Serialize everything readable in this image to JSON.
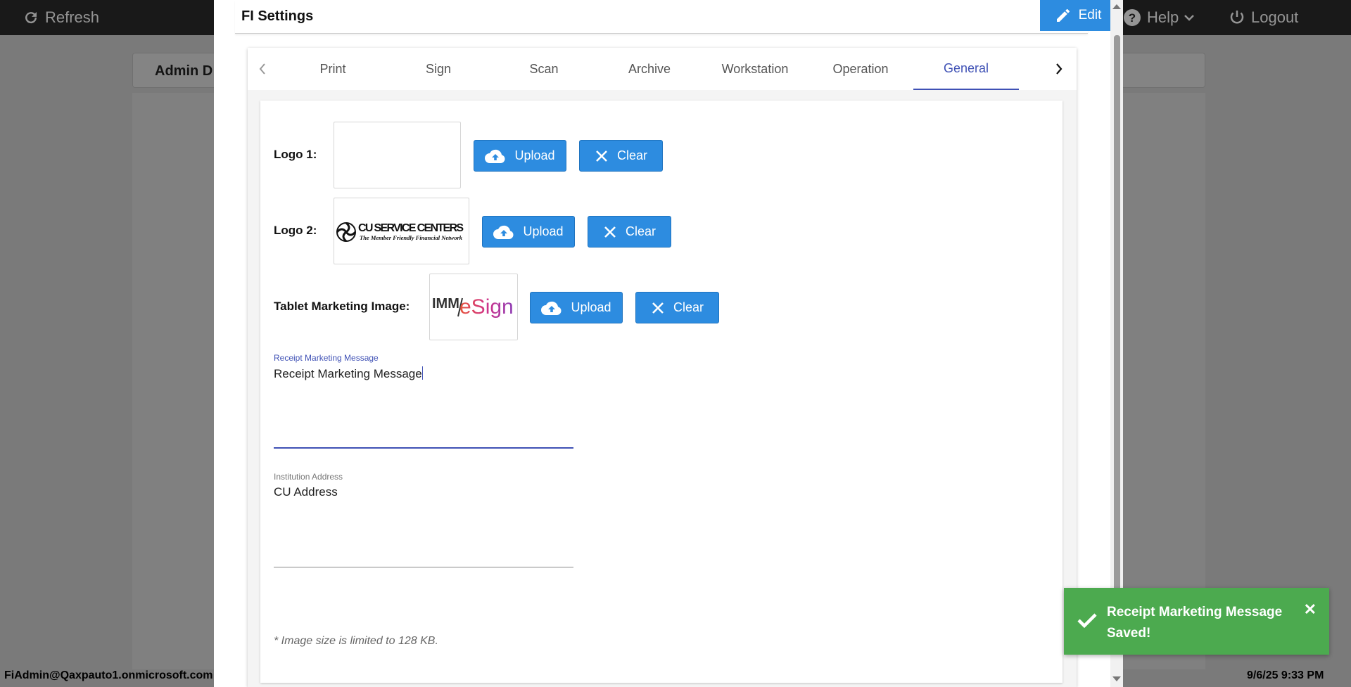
{
  "topbar": {
    "refresh_label": "Refresh",
    "help_label": "Help",
    "logout_label": "Logout"
  },
  "background": {
    "admin_title": "Admin D",
    "footer_user": "FiAdmin@Qaxpauto1.onmicrosoft.com",
    "footer_datetime": "9/6/25 9:33 PM"
  },
  "dialog": {
    "title": "FI Settings",
    "edit_label": "Edit",
    "tabs": [
      {
        "label": "Print"
      },
      {
        "label": "Sign"
      },
      {
        "label": "Scan"
      },
      {
        "label": "Archive"
      },
      {
        "label": "Workstation"
      },
      {
        "label": "Operation"
      },
      {
        "label": "General",
        "active": true
      }
    ],
    "general": {
      "logo1": {
        "label": "Logo 1:",
        "upload_label": "Upload",
        "clear_label": "Clear"
      },
      "logo2": {
        "label": "Logo 2:",
        "upload_label": "Upload",
        "clear_label": "Clear",
        "image_text_main": "CU SERVICE CENTERS",
        "image_text_sub": "The Member Friendly Financial Network"
      },
      "tablet": {
        "label": "Tablet Marketing Image:",
        "upload_label": "Upload",
        "clear_label": "Clear",
        "image_text_imm": "IMM",
        "image_text_esign": "eSign"
      },
      "receipt_message": {
        "label": "Receipt Marketing Message",
        "value": "Receipt Marketing Message"
      },
      "institution_address": {
        "label": "Institution Address",
        "value": "CU Address"
      },
      "note": "* Image size is limited to 128 KB."
    }
  },
  "toast": {
    "message": "Receipt Marketing Message Saved!",
    "color": "#4caa4f"
  },
  "colors": {
    "accent": "#2d8ce0",
    "tab_active": "#3f51b5"
  }
}
